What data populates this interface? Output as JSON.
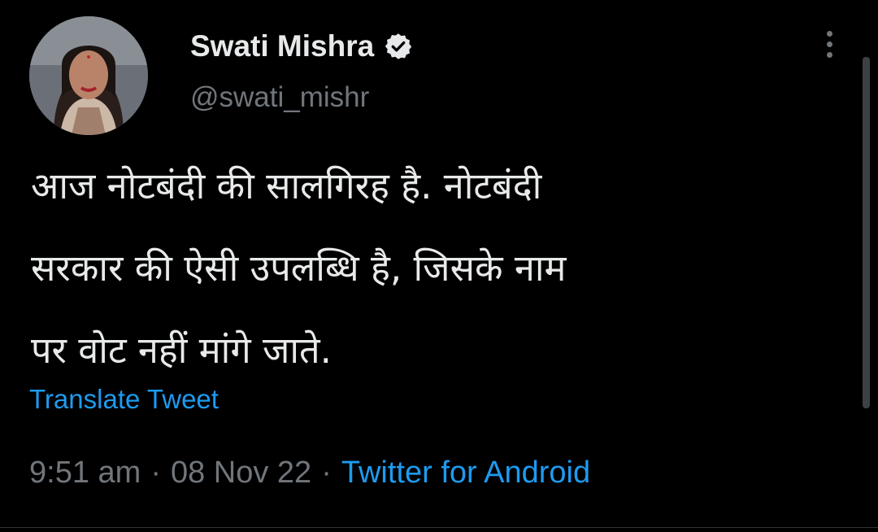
{
  "author": {
    "display_name": "Swati Mishra",
    "handle": "@swati_mishr",
    "verified_icon": "verified-badge-icon"
  },
  "tweet": {
    "lines": [
      "आज नोटबंदी की सालगिरह है. नोटबंदी",
      "सरकार की ऐसी उपलब्धि है, जिसके नाम",
      "पर वोट नहीं मांगे जाते."
    ]
  },
  "translate_label": "Translate Tweet",
  "meta": {
    "time": "9:51 am",
    "separator": "·",
    "date": "08 Nov 22",
    "source": "Twitter for Android"
  },
  "colors": {
    "background": "#000000",
    "text": "#e7e9ea",
    "muted": "#71767b",
    "accent": "#1d9bf0"
  }
}
